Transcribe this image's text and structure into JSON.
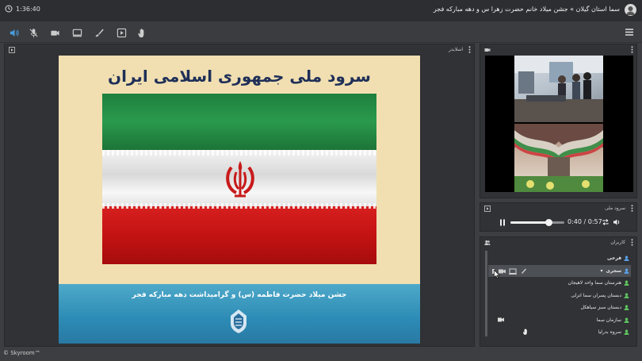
{
  "topbar": {
    "time": "1:36:40",
    "title": "سما استان گیلان » جشن میلاد خانم حضرت زهرا س و دهه مبارکه فجر"
  },
  "colors": {
    "accent_blue": "#4a9fe0",
    "user_green": "#5fc35f",
    "user_blue": "#5aa0e6",
    "panel_bg": "#303235",
    "app_bg": "#3c3e41"
  },
  "toolbar": {
    "icons": [
      "speaker-icon",
      "mic-off-icon",
      "camera-icon",
      "screen-icon",
      "brush-icon",
      "media-icon",
      "hand-icon"
    ],
    "menu": "hamburger-icon"
  },
  "slides_panel": {
    "title": "اسلایدر",
    "slide": {
      "title": "سرود ملی جمهوری اسلامی ایران",
      "caption": "جشن میلاد حضرت فاطمه (س) و گرامیداشت دهه مبارکه فجر"
    }
  },
  "media_panel": {
    "title": "سرود ملی",
    "time_current": "0:40",
    "time_separator": "/",
    "time_total": "0:57",
    "progress": 0.7
  },
  "users_panel": {
    "title": "کاربران",
    "users": [
      {
        "name": "فرخی",
        "color": "#5aa0e6",
        "bold": true
      },
      {
        "name": "سجری",
        "color": "#5aa0e6",
        "bold": true,
        "selected": true
      },
      {
        "name": "هنرستان سما واحد لاهیجان",
        "color": "#5fc35f"
      },
      {
        "name": "دبستان پسران سما انزلی",
        "color": "#5fc35f"
      },
      {
        "name": "دبستان سبز سیاهکل",
        "color": "#5fc35f"
      },
      {
        "name": "سازمان سما",
        "color": "#5fc35f"
      },
      {
        "name": "سروه بدرلیا",
        "color": "#5fc35f"
      }
    ]
  },
  "footer": {
    "brand": "© Skyroom™"
  }
}
